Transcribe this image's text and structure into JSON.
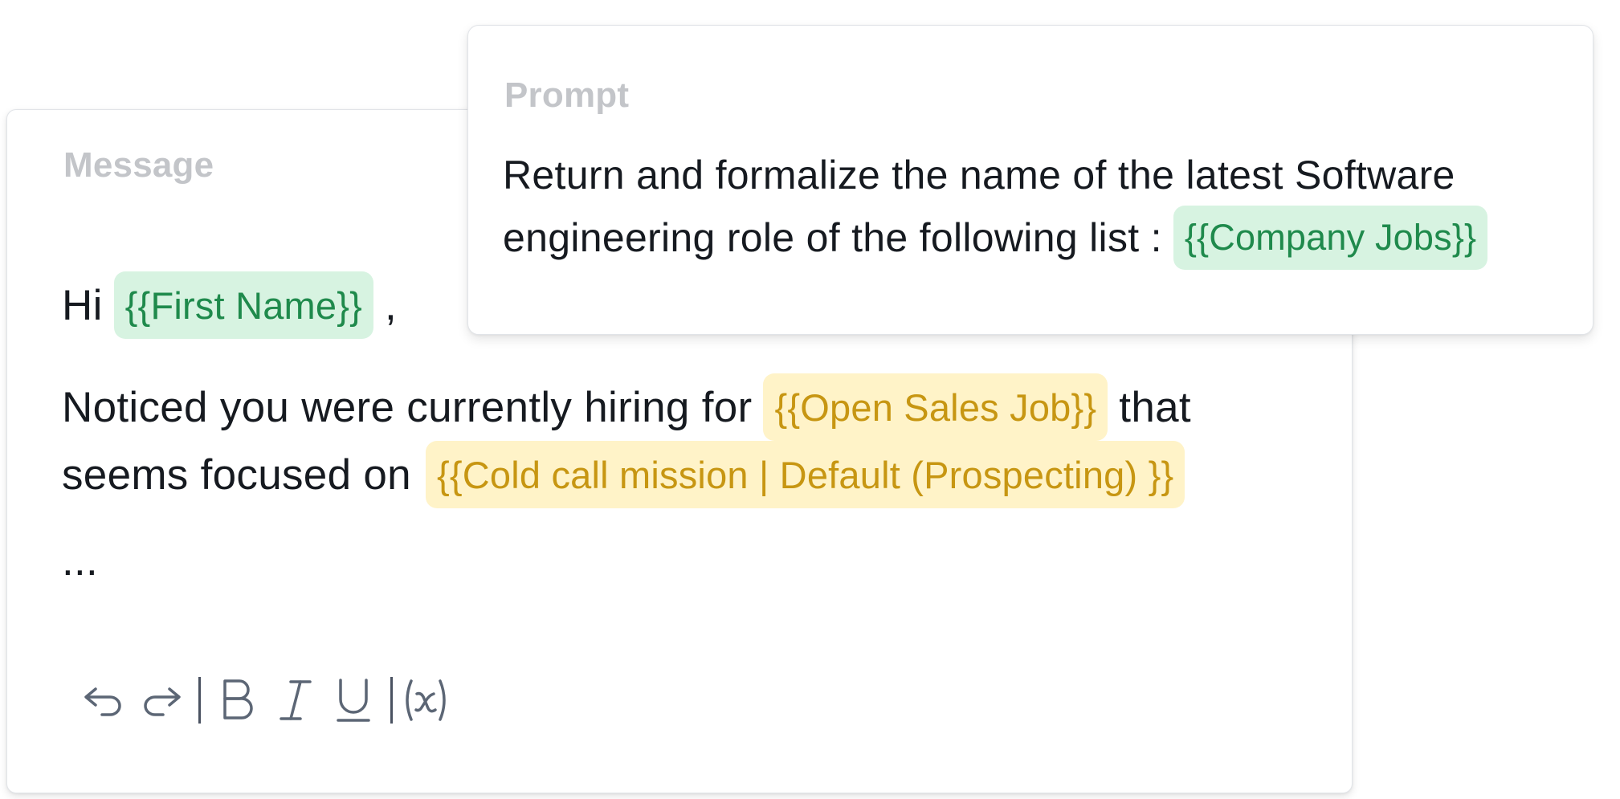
{
  "message": {
    "label": "Message",
    "greeting_prefix": "Hi",
    "first_name_var": "{{First Name}}",
    "greeting_suffix": ",",
    "line2_text": "Noticed you were currently hiring for",
    "open_sales_job_var": "{{Open Sales Job}}",
    "line2_tail": "that",
    "line3_text": "seems focused on",
    "cold_call_var": "{{Cold call mission | Default (Prospecting) }}",
    "ellipsis": "..."
  },
  "toolbar": {
    "buttons": [
      {
        "icon": "undo-icon"
      },
      {
        "icon": "redo-icon"
      },
      {
        "icon": "bold-icon",
        "glyph": "B"
      },
      {
        "icon": "italic-icon",
        "glyph": "I"
      },
      {
        "icon": "underline-icon",
        "glyph": "U"
      },
      {
        "icon": "variable-icon",
        "glyph": "(x)"
      }
    ]
  },
  "prompt": {
    "label": "Prompt",
    "line1": "Return and formalize the name of the latest Software",
    "line2": "engineering role of the following list :",
    "company_jobs_var": "{{Company Jobs}}"
  },
  "colors": {
    "green_chip_bg": "#d7f3e1",
    "green_chip_text": "#1f8a4c",
    "yellow_chip_bg": "#fff3c8",
    "yellow_chip_text": "#c79612",
    "label_gray": "#c3c5c9",
    "body_text": "#161a20",
    "toolbar_icon": "#5c6675"
  }
}
